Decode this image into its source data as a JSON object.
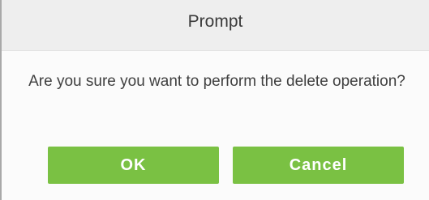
{
  "dialog": {
    "title": "Prompt",
    "message": "Are you sure you want to perform the delete operation?",
    "buttons": {
      "ok_label": "OK",
      "cancel_label": "Cancel"
    }
  },
  "colors": {
    "header_background": "#eeeeee",
    "body_background": "#fbfbfb",
    "button_green": "#7ac143",
    "button_text": "#ffffff",
    "text": "#3f3f3f"
  }
}
